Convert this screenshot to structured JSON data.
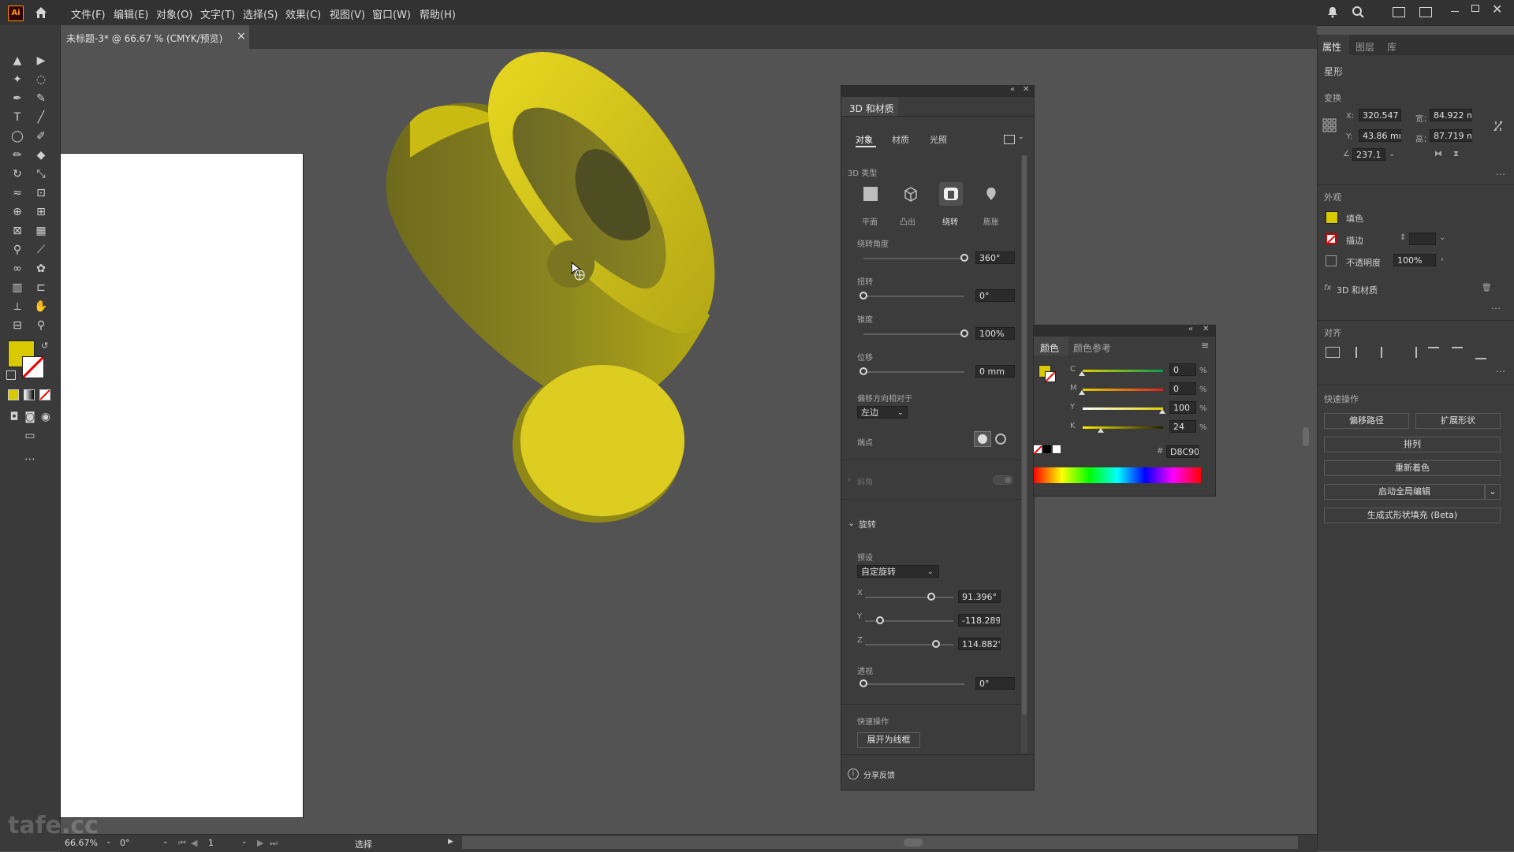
{
  "app": {
    "logo": "Ai"
  },
  "menu": [
    "文件(F)",
    "编辑(E)",
    "对象(O)",
    "文字(T)",
    "选择(S)",
    "效果(C)",
    "视图(V)",
    "窗口(W)",
    "帮助(H)"
  ],
  "document": {
    "tab_title": "未标题-3* @ 66.67 % (CMYK/预览)",
    "close_glyph": "×"
  },
  "colors": {
    "fill": "#D8C900",
    "panel": "#3c3c3c",
    "canvas": "#535353"
  },
  "panel3d": {
    "title": "3D 和材质",
    "tabs": [
      "对象",
      "材质",
      "光照"
    ],
    "type_label": "3D 类型",
    "types": [
      "平面",
      "凸出",
      "绕转",
      "膨胀"
    ],
    "revolve_angle": {
      "label": "绕转角度",
      "value": "360°",
      "fraction": 1.0
    },
    "twist": {
      "label": "扭转",
      "value": "0°",
      "fraction": 0.0
    },
    "taper": {
      "label": "锥度",
      "value": "100%",
      "fraction": 1.0
    },
    "offset": {
      "label": "位移",
      "value": "0 mm",
      "fraction": 0.0
    },
    "offset_dir": {
      "label": "偏移方向相对于",
      "value": "左边"
    },
    "cap_label": "端点",
    "bevel_label": "斜角",
    "rotation_section": "旋转",
    "preset": {
      "label": "预设",
      "value": "自定旋转"
    },
    "rot_x": {
      "label": "X",
      "value": "91.396°",
      "fraction": 0.75
    },
    "rot_y": {
      "label": "Y",
      "value": "-118.289",
      "fraction": 0.17
    },
    "rot_z": {
      "label": "Z",
      "value": "114.882°",
      "fraction": 0.8
    },
    "perspective": {
      "label": "透视",
      "value": "0°",
      "fraction": 0.0
    },
    "quick_actions_label": "快速操作",
    "expand_wireframe": "展开为线框",
    "feedback": "分享反馈"
  },
  "color_panel": {
    "tabs": [
      "颜色",
      "颜色参考"
    ],
    "channels": [
      {
        "name": "C",
        "value": "0",
        "fraction": 0.0
      },
      {
        "name": "M",
        "value": "0",
        "fraction": 0.0
      },
      {
        "name": "Y",
        "value": "100",
        "fraction": 1.0
      },
      {
        "name": "K",
        "value": "24",
        "fraction": 0.24
      }
    ],
    "percent": "%",
    "hex_label": "#",
    "hex": "D8C900"
  },
  "properties": {
    "tabs": [
      "属性",
      "图层",
      "库"
    ],
    "object_type": "星形",
    "transform_label": "变换",
    "x_label": "X:",
    "x": "320.547",
    "y_label": "Y:",
    "y": "43.86 mm",
    "w_label": "宽：",
    "w": "84.922 m",
    "h_label": "高：",
    "h": "87.719 m",
    "angle": "237.1",
    "appearance_label": "外观",
    "fill_label": "填色",
    "stroke_label": "描边",
    "opacity_label": "不透明度",
    "opacity": "100%",
    "fx_label": "fx",
    "effect": "3D 和材质",
    "align_label": "对齐",
    "quick_label": "快速操作",
    "buttons": {
      "offset_path": "偏移路径",
      "expand_shape": "扩展形状",
      "arrange": "排列",
      "recolor": "重新着色",
      "global_edit": "启动全局编辑",
      "gen_fill": "生成式形状填充 (Beta)"
    }
  },
  "status": {
    "zoom": "66.67%",
    "rotate": "0°",
    "page": "1",
    "tool": "选择"
  },
  "watermark": "tafe.cc"
}
